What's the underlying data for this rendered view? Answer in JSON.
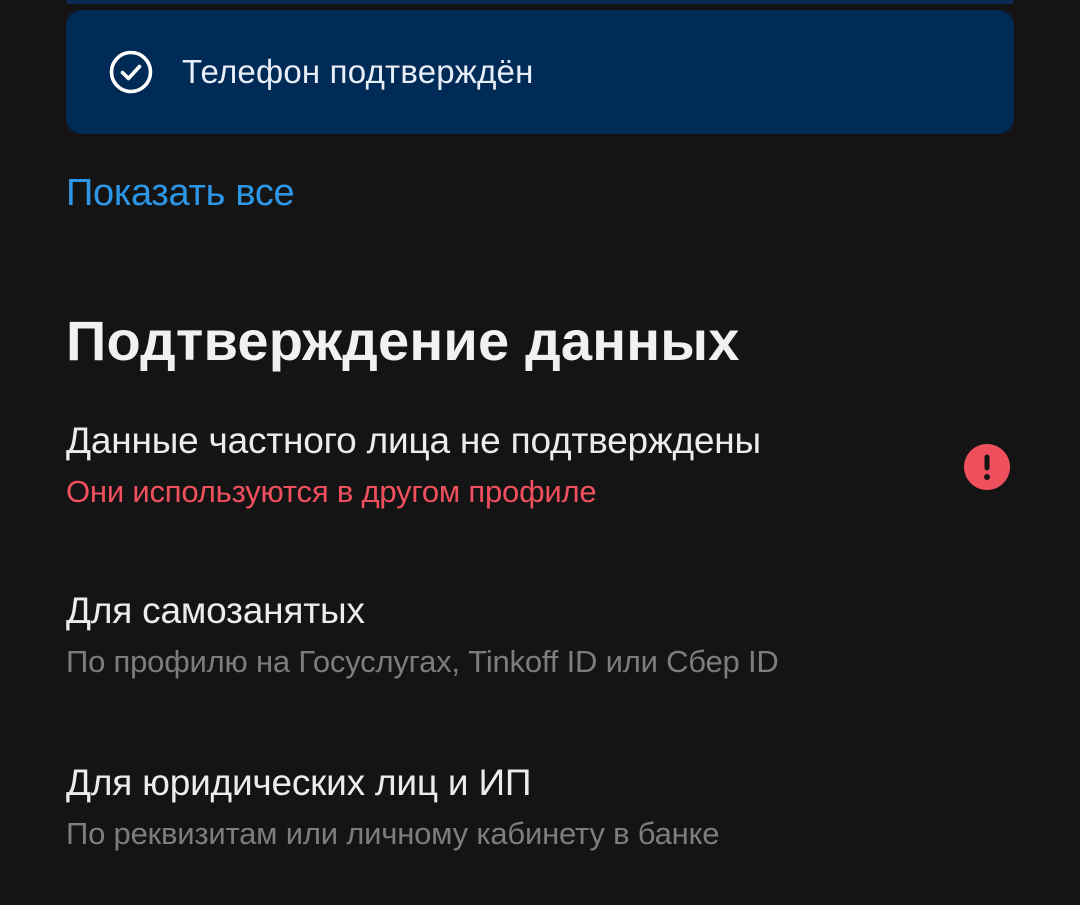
{
  "colors": {
    "background": "#141414",
    "card": "#002b57",
    "link": "#2d96e6",
    "error": "#f0505e",
    "muted": "#7d7d7d",
    "text": "#ececec"
  },
  "phone_status": {
    "icon": "check-circle-icon",
    "label": "Телефон подтверждён"
  },
  "show_all_link": "Показать все",
  "verification": {
    "title": "Подтверждение данных",
    "items": [
      {
        "title": "Данные частного лица не подтверждены",
        "subtitle": "Они используются в другом профиле",
        "icon": "alert-icon"
      },
      {
        "title": "Для самозанятых",
        "subtitle": "По профилю на Госуслугах, Tinkoff ID или Сбер ID"
      },
      {
        "title": "Для юридических лиц и ИП",
        "subtitle": "По реквизитам или личному кабинету в банке"
      }
    ]
  }
}
